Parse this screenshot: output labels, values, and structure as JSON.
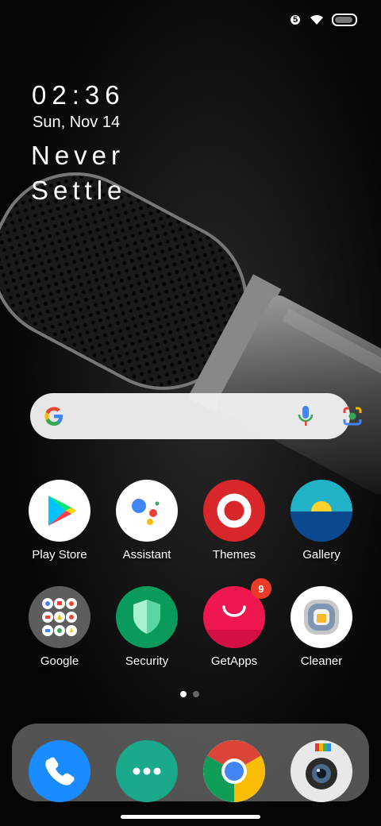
{
  "status": {
    "notification_count": "5"
  },
  "widget": {
    "time": "02:36",
    "date": "Sun, Nov 14",
    "motto_line1": "Never",
    "motto_line2": "Settle"
  },
  "search": {
    "icons": [
      "google-g-icon",
      "microphone-icon",
      "google-lens-icon"
    ]
  },
  "apps": [
    {
      "label": "Play Store"
    },
    {
      "label": "Assistant"
    },
    {
      "label": "Themes"
    },
    {
      "label": "Gallery"
    },
    {
      "label": "Google"
    },
    {
      "label": "Security"
    },
    {
      "label": "GetApps",
      "badge": "9"
    },
    {
      "label": "Cleaner"
    }
  ],
  "dock": {
    "icons": [
      "phone-icon",
      "messages-icon",
      "chrome-icon",
      "camera-icon"
    ]
  },
  "pages": {
    "count": 2,
    "active": 1
  },
  "colors": {
    "badge": "#e93b28",
    "themes_red": "#d9262b",
    "security_green": "#0a9a5c",
    "getapps_pink": "#f0164f",
    "phone_blue": "#1a8cff",
    "messages_teal": "#1aa98a"
  }
}
